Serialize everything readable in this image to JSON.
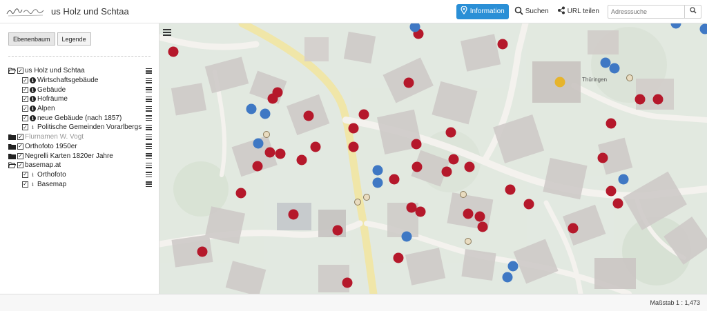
{
  "app": {
    "title": "us Holz und Schtaa"
  },
  "header": {
    "info_label": "Information",
    "search_label": "Suchen",
    "share_label": "URL teilen",
    "address_placeholder": "Adresssuche"
  },
  "sidebar": {
    "tabs": [
      "Ebenenbaum",
      "Legende"
    ],
    "tree": [
      {
        "label": "us Holz und Schtaa",
        "level": 0,
        "folder": "open",
        "checked": true,
        "info": false,
        "muted": false
      },
      {
        "label": "Wirtschaftsgebäude",
        "level": 1,
        "folder": "",
        "checked": true,
        "info": "dark",
        "muted": false
      },
      {
        "label": "Gebäude",
        "level": 1,
        "folder": "",
        "checked": true,
        "info": "dark",
        "muted": false
      },
      {
        "label": "Hofräume",
        "level": 1,
        "folder": "",
        "checked": true,
        "info": "dark",
        "muted": false
      },
      {
        "label": "Alpen",
        "level": 1,
        "folder": "",
        "checked": true,
        "info": "dark",
        "muted": false
      },
      {
        "label": "neue Gebäude (nach 1857)",
        "level": 1,
        "folder": "",
        "checked": true,
        "info": "dark",
        "muted": false
      },
      {
        "label": "Politische Gemeinden Vorarlbergs",
        "level": 1,
        "folder": "",
        "checked": true,
        "info": "light",
        "muted": false
      },
      {
        "label": "Flurnamen W. Vogt",
        "level": 0,
        "folder": "closed",
        "checked": true,
        "info": false,
        "muted": true
      },
      {
        "label": "Orthofoto 1950er",
        "level": 0,
        "folder": "closed",
        "checked": true,
        "info": false,
        "muted": false
      },
      {
        "label": "Negrelli Karten 1820er Jahre",
        "level": 0,
        "folder": "closed",
        "checked": true,
        "info": false,
        "muted": false
      },
      {
        "label": "basemap.at",
        "level": 0,
        "folder": "open",
        "checked": true,
        "info": false,
        "muted": false
      },
      {
        "label": "Orthofoto",
        "level": 1,
        "folder": "",
        "checked": true,
        "info": "light",
        "muted": false
      },
      {
        "label": "Basemap",
        "level": 1,
        "folder": "",
        "checked": true,
        "info": "light",
        "muted": false
      }
    ]
  },
  "map": {
    "labels": {
      "place": "Thüringen"
    },
    "colors": {
      "red": "#b5182b",
      "blue": "#3f78c4",
      "beige": "#e9dcc0",
      "yellow": "#e6b42c",
      "road": "#f1e7a6"
    }
  },
  "footer": {
    "scale_label": "Maßstab 1 : 1,473"
  }
}
